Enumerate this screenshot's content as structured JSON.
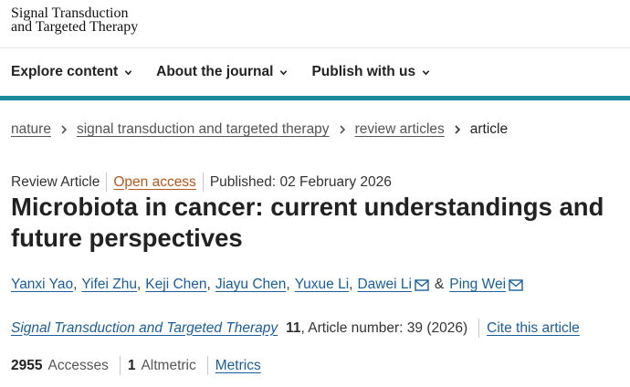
{
  "logo": {
    "line1": "Signal Transduction",
    "line2": "and Targeted Therapy"
  },
  "nav": [
    {
      "label": "Explore content"
    },
    {
      "label": "About the journal"
    },
    {
      "label": "Publish with us"
    }
  ],
  "breadcrumb": {
    "items": [
      "nature",
      "signal transduction and targeted therapy",
      "review articles"
    ],
    "current": "article"
  },
  "article": {
    "type": "Review Article",
    "access": "Open access",
    "published": "Published: 02 February 2026",
    "title": "Microbiota in cancer: current understandings and future perspectives",
    "authors": [
      "Yanxi Yao",
      "Yifei Zhu",
      "Keji Chen",
      "Jiayu Chen",
      "Yuxue Li",
      "Dawei Li",
      "Ping Wei"
    ],
    "author_joiner": "&",
    "journal_name": "Signal Transduction and Targeted Therapy",
    "volume": "11",
    "article_number": ", Article number: 39 (2026)",
    "cite": "Cite this article"
  },
  "metrics": {
    "accesses_count": "2955",
    "accesses_label": "Accesses",
    "altmetric_count": "1",
    "altmetric_label": "Altmetric",
    "metrics_link": "Metrics"
  },
  "colors": {
    "accent_bar": "#1b8a9b",
    "link": "#1a5d9c",
    "open_access": "#b6571c"
  },
  "icons": [
    "chevron-down-icon",
    "chevron-right-icon",
    "mail-icon"
  ]
}
